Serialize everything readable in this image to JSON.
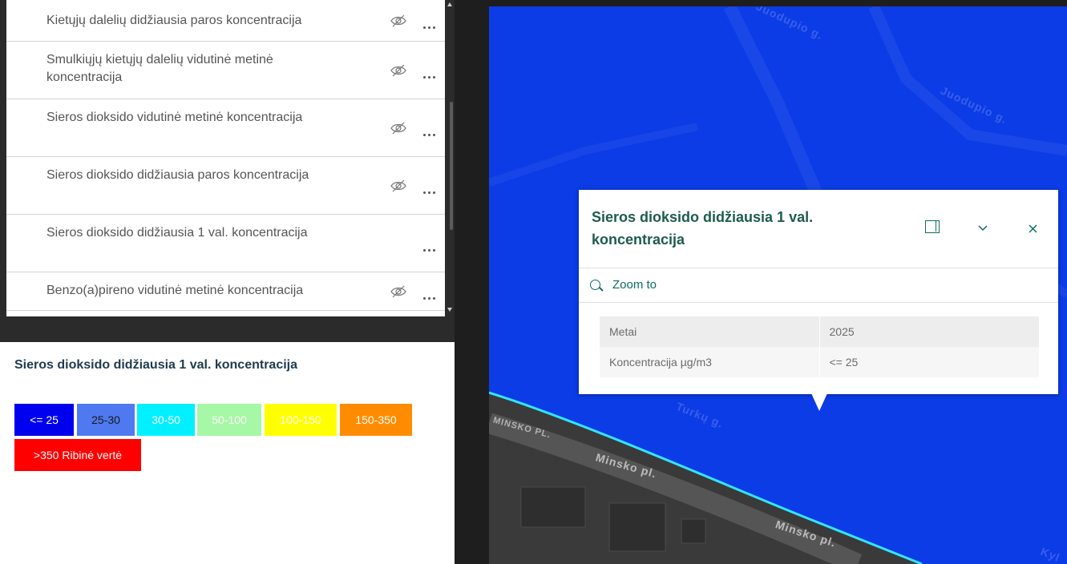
{
  "layers": [
    {
      "title": "Kietųjų dalelių didžiausia paros koncentracija",
      "hidden_icon": true
    },
    {
      "title": "Smulkiųjų kietųjų dalelių vidutinė metinė koncentracija",
      "hidden_icon": true
    },
    {
      "title": "Sieros dioksido vidutinė metinė koncentracija",
      "hidden_icon": true
    },
    {
      "title": "Sieros dioksido didžiausia paros koncentracija",
      "hidden_icon": true
    },
    {
      "title": "Sieros dioksido didžiausia 1 val. koncentracija",
      "hidden_icon": false
    },
    {
      "title": "Benzo(a)pireno vidutinė metinė koncentracija",
      "hidden_icon": true
    }
  ],
  "legend": {
    "title": "Sieros dioksido didžiausia 1 val. koncentracija",
    "classes": [
      {
        "label": "<= 25",
        "color": "#0000ee",
        "text_color": "#ffffff"
      },
      {
        "label": "25-30",
        "color": "#4f79f0",
        "text_color": "#1a1a1a"
      },
      {
        "label": "30-50",
        "color": "#00f0ff",
        "text_color": "#ffffff"
      },
      {
        "label": "50-100",
        "color": "#a6f7a6",
        "text_color": "#ffffff"
      },
      {
        "label": "100-150",
        "color": "#ffff00",
        "text_color": "#ffffff"
      },
      {
        "label": "150-350",
        "color": "#ff8c00",
        "text_color": "#ffffff"
      },
      {
        "label": ">350 Ribinė vertė",
        "color": "#ff0000",
        "text_color": "#ffffff"
      }
    ]
  },
  "map": {
    "streets": [
      "Juodupio g.",
      "Juodupio g.",
      "MINSKO PL.",
      "Minsko pl.",
      "Minsko pl.",
      "Turkų g.",
      "Kyl"
    ]
  },
  "popup": {
    "title": "Sieros dioksido didžiausia 1 val. koncentracija",
    "zoom_label": "Zoom to",
    "rows": [
      {
        "field": "Metai",
        "value": "2025"
      },
      {
        "field": "Koncentracija µg/m3",
        "value": "<= 25"
      }
    ]
  }
}
